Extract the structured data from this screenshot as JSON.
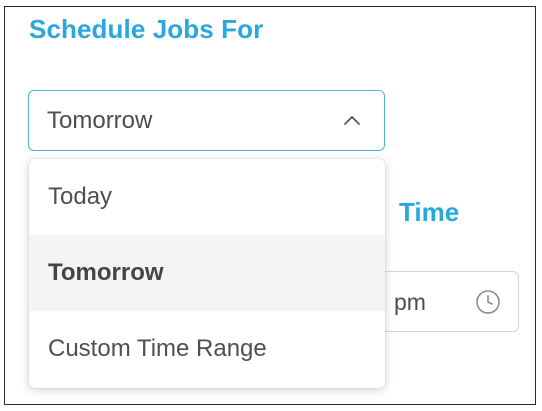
{
  "section_title": "Schedule Jobs For",
  "select": {
    "value": "Tomorrow",
    "icon": "chevron-up-icon"
  },
  "options": [
    {
      "label": "Today",
      "selected": false
    },
    {
      "label": "Tomorrow",
      "selected": true
    },
    {
      "label": "Custom Time Range",
      "selected": false
    }
  ],
  "background": {
    "title_fragment": "Time",
    "time_value": "pm",
    "time_icon": "clock-icon"
  },
  "colors": {
    "accent": "#29a8df",
    "select_border": "#49b3e6",
    "selected_bg": "#f4f4f4"
  }
}
